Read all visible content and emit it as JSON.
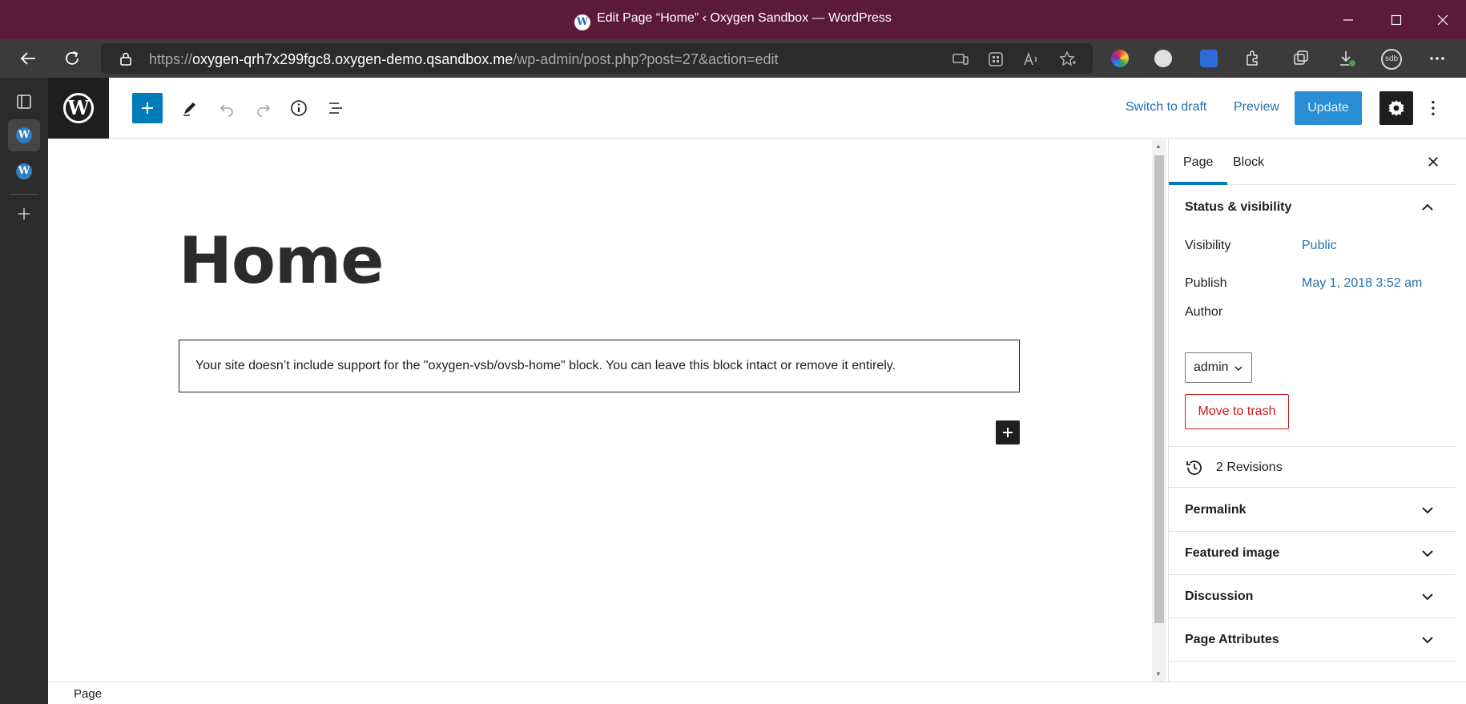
{
  "browser": {
    "window_title": "Edit Page “Home” ‹ Oxygen Sandbox — WordPress",
    "url_prefix": "https://",
    "url_host": "oxygen-qrh7x299fgc8.oxygen-demo.qsandbox.me",
    "url_path": "/wp-admin/post.php?post=27&action=edit",
    "profile_initials": "sdb",
    "title_bar_color": "#5b1a3a"
  },
  "editor_header": {
    "switch_to_draft": "Switch to draft",
    "preview": "Preview",
    "update": "Update"
  },
  "content": {
    "title": "Home",
    "missing_block_message": "Your site doesn’t include support for the \"oxygen-vsb/ovsb-home\" block. You can leave this block intact or remove it entirely."
  },
  "sidebar": {
    "tabs": [
      "Page",
      "Block"
    ],
    "status_visibility": {
      "heading": "Status & visibility",
      "visibility_label": "Visibility",
      "visibility_value": "Public",
      "publish_label": "Publish",
      "publish_value": "May 1, 2018 3:52 am",
      "author_label": "Author",
      "author_value": "admin",
      "trash_label": "Move to trash"
    },
    "revisions": "2 Revisions",
    "panels": [
      "Permalink",
      "Featured image",
      "Discussion",
      "Page Attributes"
    ]
  },
  "footer": {
    "breadcrumb": "Page"
  },
  "colors": {
    "accent": "#007cba",
    "link": "#2271b1",
    "danger": "#cc1818"
  }
}
